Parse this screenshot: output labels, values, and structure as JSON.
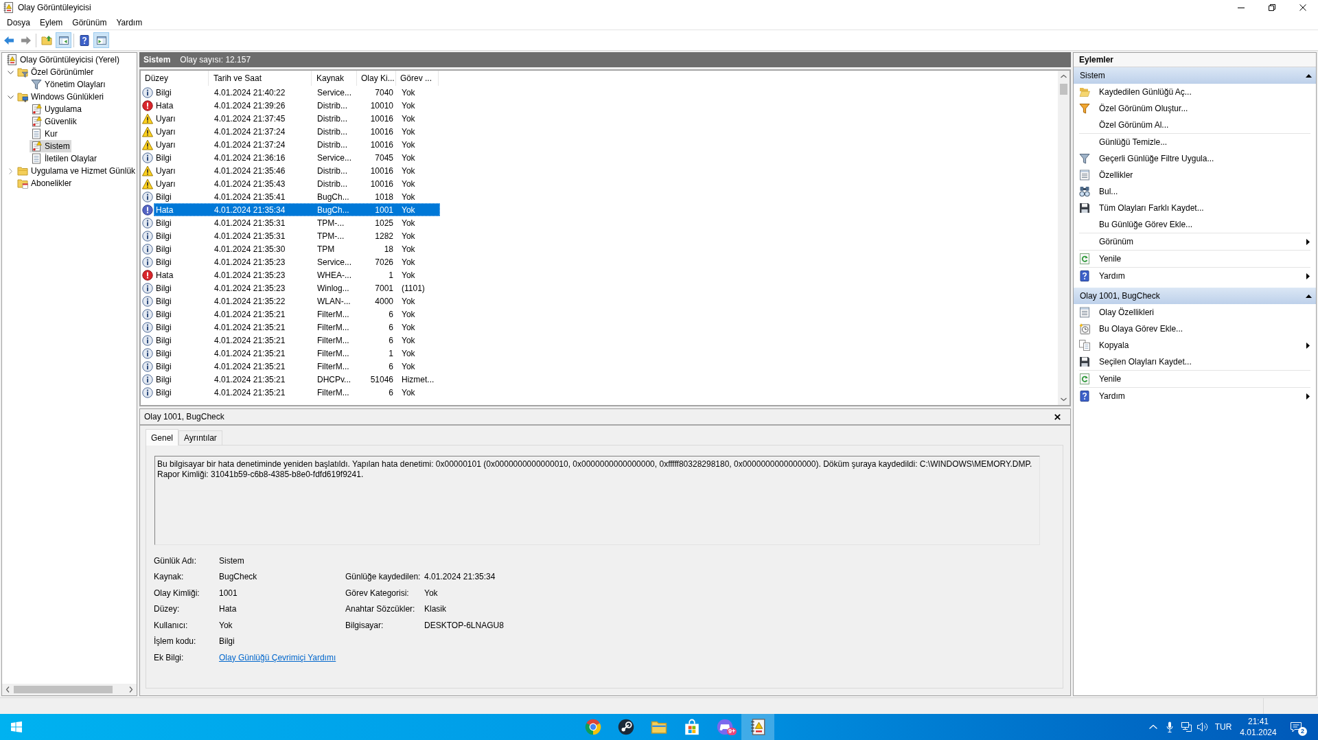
{
  "window": {
    "title": "Olay Görüntüleyicisi"
  },
  "menu": [
    "Dosya",
    "Eylem",
    "Görünüm",
    "Yardım"
  ],
  "toolbar": [
    [
      {
        "kind": "back",
        "pressed": false,
        "disabled": false
      },
      {
        "kind": "forward",
        "pressed": false,
        "disabled": true
      }
    ],
    [
      {
        "kind": "up",
        "pressed": false,
        "disabled": false
      },
      {
        "kind": "tree-pane",
        "pressed": true,
        "disabled": false
      }
    ],
    [
      {
        "kind": "help",
        "pressed": false,
        "disabled": false
      },
      {
        "kind": "action-pane",
        "pressed": true,
        "disabled": false
      }
    ]
  ],
  "tree": [
    {
      "label": "Olay Görüntüleyicisi (Yerel)",
      "kind": "viewer",
      "selected": false,
      "children": [
        {
          "label": "Özel Görünümler",
          "kind": "folder-filter",
          "selected": false,
          "expanded": true,
          "children": [
            {
              "label": "Yönetim Olayları",
              "kind": "filter",
              "selected": false
            }
          ]
        },
        {
          "label": "Windows Günlükleri",
          "kind": "folder-pc",
          "selected": false,
          "expanded": true,
          "children": [
            {
              "label": "Uygulama",
              "kind": "log-mark",
              "selected": false
            },
            {
              "label": "Güvenlik",
              "kind": "log-mark",
              "selected": false
            },
            {
              "label": "Kur",
              "kind": "log-plain",
              "selected": false
            },
            {
              "label": "Sistem",
              "kind": "log-mark",
              "selected": true
            },
            {
              "label": "İletilen Olaylar",
              "kind": "log-plain",
              "selected": false
            }
          ]
        },
        {
          "label": "Uygulama ve Hizmet Günlük",
          "kind": "folder",
          "selected": false,
          "expanded": false
        },
        {
          "label": "Abonelikler",
          "kind": "subscriptions",
          "selected": false
        }
      ]
    }
  ],
  "log_header": {
    "title": "Sistem",
    "event_count": "Olay sayısı: 12.157"
  },
  "table": {
    "columns": [
      "Düzey",
      "Tarih ve Saat",
      "Kaynak",
      "Olay Ki...",
      "Görev ..."
    ],
    "rows": [
      {
        "kind": "info",
        "selected": false,
        "cells": [
          "Bilgi",
          "4.01.2024 21:40:22",
          "Service...",
          "7040",
          "Yok"
        ]
      },
      {
        "kind": "error",
        "selected": false,
        "cells": [
          "Hata",
          "4.01.2024 21:39:26",
          "Distrib...",
          "10010",
          "Yok"
        ]
      },
      {
        "kind": "warning",
        "selected": false,
        "cells": [
          "Uyarı",
          "4.01.2024 21:37:45",
          "Distrib...",
          "10016",
          "Yok"
        ]
      },
      {
        "kind": "warning",
        "selected": false,
        "cells": [
          "Uyarı",
          "4.01.2024 21:37:24",
          "Distrib...",
          "10016",
          "Yok"
        ]
      },
      {
        "kind": "warning",
        "selected": false,
        "cells": [
          "Uyarı",
          "4.01.2024 21:37:24",
          "Distrib...",
          "10016",
          "Yok"
        ]
      },
      {
        "kind": "info",
        "selected": false,
        "cells": [
          "Bilgi",
          "4.01.2024 21:36:16",
          "Service...",
          "7045",
          "Yok"
        ]
      },
      {
        "kind": "warning",
        "selected": false,
        "cells": [
          "Uyarı",
          "4.01.2024 21:35:46",
          "Distrib...",
          "10016",
          "Yok"
        ]
      },
      {
        "kind": "warning",
        "selected": false,
        "cells": [
          "Uyarı",
          "4.01.2024 21:35:43",
          "Distrib...",
          "10016",
          "Yok"
        ]
      },
      {
        "kind": "info",
        "selected": false,
        "cells": [
          "Bilgi",
          "4.01.2024 21:35:41",
          "BugCh...",
          "1018",
          "Yok"
        ]
      },
      {
        "kind": "error",
        "selected": true,
        "cells": [
          "Hata",
          "4.01.2024 21:35:34",
          "BugCh...",
          "1001",
          "Yok"
        ]
      },
      {
        "kind": "info",
        "selected": false,
        "cells": [
          "Bilgi",
          "4.01.2024 21:35:31",
          "TPM-...",
          "1025",
          "Yok"
        ]
      },
      {
        "kind": "info",
        "selected": false,
        "cells": [
          "Bilgi",
          "4.01.2024 21:35:31",
          "TPM-...",
          "1282",
          "Yok"
        ]
      },
      {
        "kind": "info",
        "selected": false,
        "cells": [
          "Bilgi",
          "4.01.2024 21:35:30",
          "TPM",
          "18",
          "Yok"
        ]
      },
      {
        "kind": "info",
        "selected": false,
        "cells": [
          "Bilgi",
          "4.01.2024 21:35:23",
          "Service...",
          "7026",
          "Yok"
        ]
      },
      {
        "kind": "error",
        "selected": false,
        "cells": [
          "Hata",
          "4.01.2024 21:35:23",
          "WHEA-...",
          "1",
          "Yok"
        ]
      },
      {
        "kind": "info",
        "selected": false,
        "cells": [
          "Bilgi",
          "4.01.2024 21:35:23",
          "Winlog...",
          "7001",
          "(1101)"
        ]
      },
      {
        "kind": "info",
        "selected": false,
        "cells": [
          "Bilgi",
          "4.01.2024 21:35:22",
          "WLAN-...",
          "4000",
          "Yok"
        ]
      },
      {
        "kind": "info",
        "selected": false,
        "cells": [
          "Bilgi",
          "4.01.2024 21:35:21",
          "FilterM...",
          "6",
          "Yok"
        ]
      },
      {
        "kind": "info",
        "selected": false,
        "cells": [
          "Bilgi",
          "4.01.2024 21:35:21",
          "FilterM...",
          "6",
          "Yok"
        ]
      },
      {
        "kind": "info",
        "selected": false,
        "cells": [
          "Bilgi",
          "4.01.2024 21:35:21",
          "FilterM...",
          "6",
          "Yok"
        ]
      },
      {
        "kind": "info",
        "selected": false,
        "cells": [
          "Bilgi",
          "4.01.2024 21:35:21",
          "FilterM...",
          "1",
          "Yok"
        ]
      },
      {
        "kind": "info",
        "selected": false,
        "cells": [
          "Bilgi",
          "4.01.2024 21:35:21",
          "FilterM...",
          "6",
          "Yok"
        ]
      },
      {
        "kind": "info",
        "selected": false,
        "cells": [
          "Bilgi",
          "4.01.2024 21:35:21",
          "DHCPv...",
          "51046",
          "Hizmet..."
        ]
      },
      {
        "kind": "info",
        "selected": false,
        "cells": [
          "Bilgi",
          "4.01.2024 21:35:21",
          "FilterM...",
          "6",
          "Yok"
        ]
      }
    ]
  },
  "detail": {
    "title": "Olay 1001, BugCheck",
    "tabs": [
      {
        "label": "Genel",
        "selected": true
      },
      {
        "label": "Ayrıntılar",
        "selected": false
      }
    ],
    "message": "Bu bilgisayar bir hata denetiminde yeniden başlatıldı. Yapılan hata denetimi: 0x00000101 (0x0000000000000010, 0x0000000000000000, 0xfffff80328298180, 0x0000000000000000). Döküm şuraya kaydedildi: C:\\WINDOWS\\MEMORY.DMP. Rapor Kimliği: 31041b59-c6b8-4385-b8e0-fdfd619f9241.",
    "field_rows": [
      [
        {
          "label": "Günlük Adı:",
          "value": "Sistem",
          "kind": "text"
        }
      ],
      [
        {
          "label": "Kaynak:",
          "value": "BugCheck",
          "kind": "text"
        },
        {
          "label": "Günlüğe kaydedilen:",
          "value": "4.01.2024 21:35:34",
          "kind": "text"
        }
      ],
      [
        {
          "label": "Olay Kimliği:",
          "value": "1001",
          "kind": "text"
        },
        {
          "label": "Görev Kategorisi:",
          "value": "Yok",
          "kind": "text"
        }
      ],
      [
        {
          "label": "Düzey:",
          "value": "Hata",
          "kind": "text"
        },
        {
          "label": "Anahtar Sözcükler:",
          "value": "Klasik",
          "kind": "text"
        }
      ],
      [
        {
          "label": "Kullanıcı:",
          "value": "Yok",
          "kind": "text"
        },
        {
          "label": "Bilgisayar:",
          "value": "DESKTOP-6LNAGU8",
          "kind": "text"
        }
      ],
      [
        {
          "label": "İşlem kodu:",
          "value": "Bilgi",
          "kind": "text"
        }
      ],
      [
        {
          "label": "Ek Bilgi:",
          "value": "Olay Günlüğü Çevrimiçi Yardımı",
          "kind": "link"
        }
      ]
    ]
  },
  "actions": {
    "title": "Eylemler",
    "sections": [
      {
        "title": "Sistem",
        "expanded": true,
        "groups": [
          [
            {
              "label": "Kaydedilen Günlüğü Aç...",
              "kind": "open",
              "submenu": false
            },
            {
              "label": "Özel Görünüm Oluştur...",
              "kind": "filter-color",
              "submenu": false
            },
            {
              "label": "Özel Görünüm Al...",
              "kind": "plain",
              "submenu": false
            }
          ],
          [
            {
              "label": "Günlüğü Temizle...",
              "kind": "plain",
              "submenu": false
            },
            {
              "label": "Geçerli Günlüğe Filtre Uygula...",
              "kind": "filter",
              "submenu": false
            },
            {
              "label": "Özellikler",
              "kind": "properties",
              "submenu": false
            },
            {
              "label": "Bul...",
              "kind": "find",
              "submenu": false
            },
            {
              "label": "Tüm Olayları Farklı Kaydet...",
              "kind": "save",
              "submenu": false
            },
            {
              "label": "Bu Günlüğe Görev Ekle...",
              "kind": "plain",
              "submenu": false
            }
          ],
          [
            {
              "label": "Görünüm",
              "kind": "plain",
              "submenu": true
            }
          ],
          [
            {
              "label": "Yenile",
              "kind": "refresh",
              "submenu": false
            }
          ],
          [
            {
              "label": "Yardım",
              "kind": "help",
              "submenu": true
            }
          ]
        ]
      },
      {
        "title": "Olay 1001, BugCheck",
        "expanded": true,
        "groups": [
          [
            {
              "label": "Olay Özellikleri",
              "kind": "properties",
              "submenu": false
            },
            {
              "label": "Bu Olaya Görev Ekle...",
              "kind": "task",
              "submenu": false
            },
            {
              "label": "Kopyala",
              "kind": "copy",
              "submenu": true
            },
            {
              "label": "Seçilen Olayları Kaydet...",
              "kind": "save",
              "submenu": false
            }
          ],
          [
            {
              "label": "Yenile",
              "kind": "refresh",
              "submenu": false
            }
          ],
          [
            {
              "label": "Yardım",
              "kind": "help",
              "submenu": true
            }
          ]
        ]
      }
    ]
  },
  "taskbar": {
    "apps": [
      {
        "kind": "browser",
        "active": false
      },
      {
        "kind": "steam",
        "active": false
      },
      {
        "kind": "files",
        "active": false
      },
      {
        "kind": "store",
        "active": false
      },
      {
        "kind": "chat",
        "active": false,
        "badge": "9+"
      },
      {
        "kind": "event-viewer",
        "active": true
      }
    ],
    "tray": {
      "language": "TUR",
      "time": "21:41",
      "date": "4.01.2024",
      "notification_count": "2"
    }
  }
}
